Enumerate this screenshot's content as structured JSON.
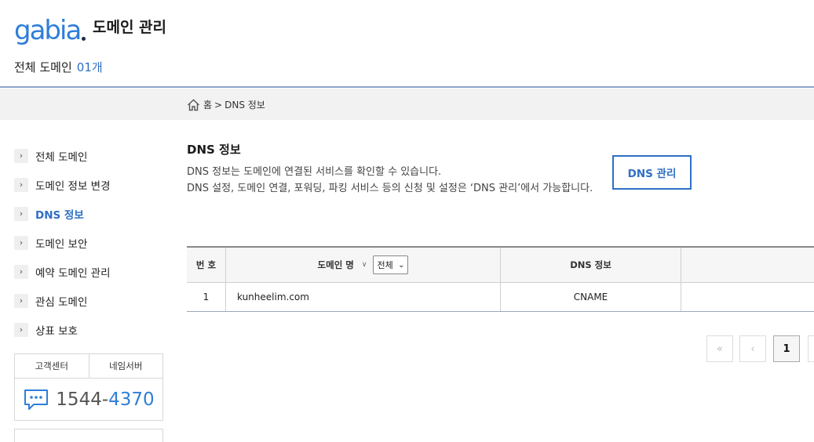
{
  "header": {
    "logo": "gabia",
    "title": "도메인 관리",
    "count_label": "전체 도메인",
    "count_value": "01개"
  },
  "breadcrumb": {
    "home": "홈",
    "sep": ">",
    "current": "DNS 정보"
  },
  "sidebar": {
    "items": [
      {
        "label": "전체 도메인",
        "active": false
      },
      {
        "label": "도메인 정보 변경",
        "active": false
      },
      {
        "label": "DNS 정보",
        "active": true
      },
      {
        "label": "도메인 보안",
        "active": false
      },
      {
        "label": "예약 도메인 관리",
        "active": false
      },
      {
        "label": "관심 도메인",
        "active": false
      },
      {
        "label": "상표 보호",
        "active": false
      }
    ],
    "support": {
      "tab1": "고객센터",
      "tab2": "네임서버",
      "phone_prefix": "1544-",
      "phone_suffix": "4370"
    }
  },
  "main": {
    "title": "DNS 정보",
    "desc_line1": "DNS 정보는 도메인에 연결된 서비스를 확인할 수 있습니다.",
    "desc_line2": "DNS 설정, 도메인 연결, 포워딩, 파킹 서비스 등의 신청 및 설정은 ‘DNS 관리’에서 가능합니다.",
    "manage_button": "DNS 관리"
  },
  "table": {
    "headers": {
      "num": "번 호",
      "domain": "도메인 명",
      "filter": "전체",
      "dns": "DNS 정보"
    },
    "rows": [
      {
        "num": "1",
        "domain": "kunheelim.com",
        "dns": "CNAME"
      }
    ]
  },
  "pagination": {
    "first": "«",
    "prev": "‹",
    "current": "1"
  },
  "colors": {
    "brand": "#2f7ed8",
    "accent": "#2f6fc4"
  }
}
